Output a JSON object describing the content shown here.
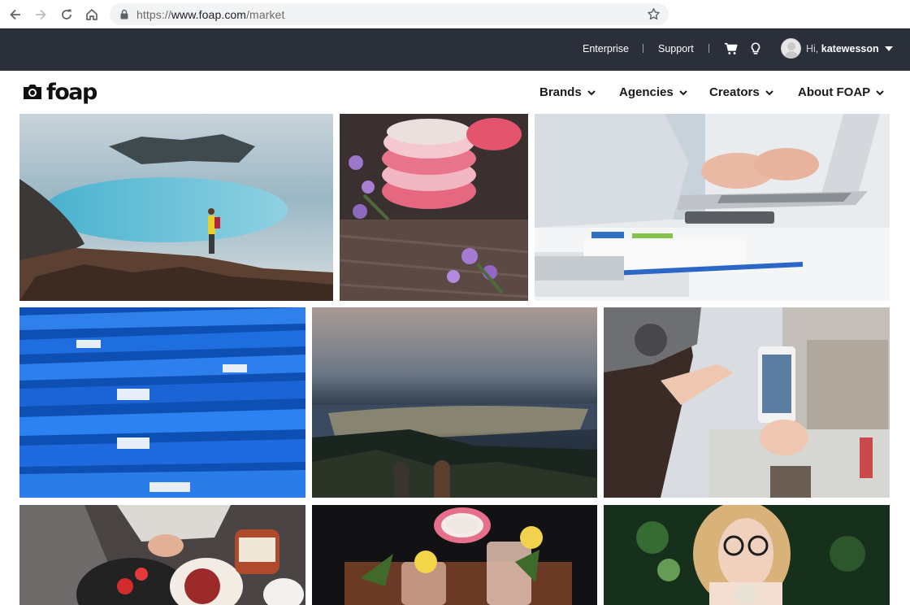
{
  "browser": {
    "url_scheme": "https://",
    "url_host": "www.foap.com",
    "url_path": "/market"
  },
  "topbar": {
    "enterprise": "Enterprise",
    "support": "Support",
    "greeting_prefix": "Hi, ",
    "username": "katewesson"
  },
  "header": {
    "logo_text": "foap",
    "menu": [
      {
        "label": "Brands"
      },
      {
        "label": "Agencies"
      },
      {
        "label": "Creators"
      },
      {
        "label": "About FOAP"
      }
    ]
  },
  "icons": {
    "back": "back-arrow-icon",
    "forward": "forward-arrow-icon",
    "reload": "reload-icon",
    "home": "home-icon",
    "lock": "lock-icon",
    "bookmark": "star-icon",
    "cart": "cart-icon",
    "ideas": "lightbulb-icon",
    "user_menu": "chevron-down-icon"
  },
  "colors": {
    "topbar_bg": "#2b2f3a",
    "text_dark": "#1a1a1a"
  }
}
